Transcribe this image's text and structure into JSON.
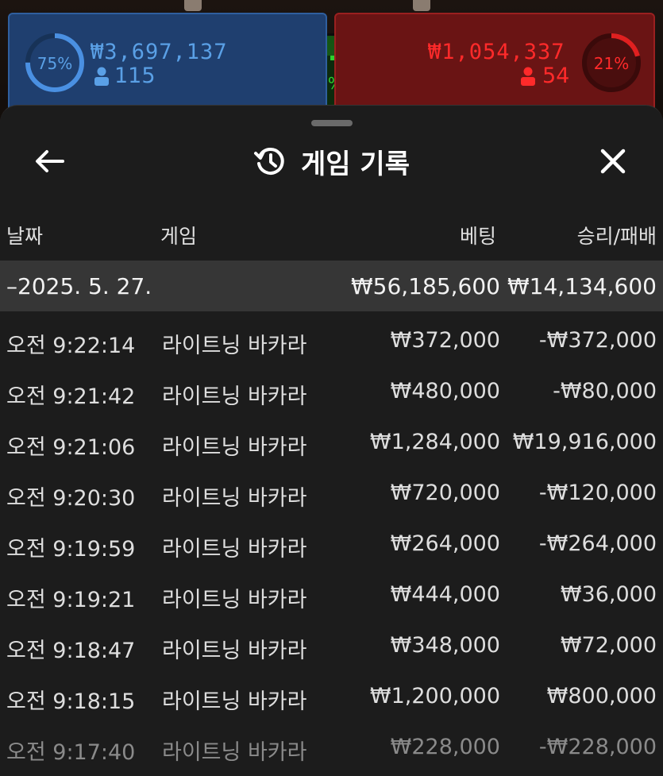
{
  "top": {
    "player": {
      "percent": "75%",
      "amount": "₩3,697,137",
      "count": "115"
    },
    "tie": {
      "percent": "4%"
    },
    "banker": {
      "percent": "21%",
      "amount": "₩1,054,337",
      "count": "54"
    }
  },
  "sheet": {
    "title": "게임 기록",
    "icons": {
      "back": "arrow-left-icon",
      "history": "history-icon",
      "close": "close-icon"
    },
    "columns": {
      "date": "날짜",
      "game": "게임",
      "bet": "베팅",
      "winloss": "승리/패배"
    },
    "date_group": {
      "date": "–2025. 5. 27.",
      "bet_total": "₩56,185,600",
      "winloss_total": "₩14,134,600"
    },
    "rows": [
      {
        "time": "오전 9:22:14",
        "game": "라이트닝 바카라",
        "bet": "₩372,000",
        "result": "-₩372,000"
      },
      {
        "time": "오전 9:21:42",
        "game": "라이트닝 바카라",
        "bet": "₩480,000",
        "result": "-₩80,000"
      },
      {
        "time": "오전 9:21:06",
        "game": "라이트닝 바카라",
        "bet": "₩1,284,000",
        "result": "₩19,916,000"
      },
      {
        "time": "오전 9:20:30",
        "game": "라이트닝 바카라",
        "bet": "₩720,000",
        "result": "-₩120,000"
      },
      {
        "time": "오전 9:19:59",
        "game": "라이트닝 바카라",
        "bet": "₩264,000",
        "result": "-₩264,000"
      },
      {
        "time": "오전 9:19:21",
        "game": "라이트닝 바카라",
        "bet": "₩444,000",
        "result": "₩36,000"
      },
      {
        "time": "오전 9:18:47",
        "game": "라이트닝 바카라",
        "bet": "₩348,000",
        "result": "₩72,000"
      },
      {
        "time": "오전 9:18:15",
        "game": "라이트닝 바카라",
        "bet": "₩1,200,000",
        "result": "₩800,000"
      },
      {
        "time": "오전 9:17:40",
        "game": "라이트닝 바카라",
        "bet": "₩228,000",
        "result": "-₩228,000"
      }
    ]
  },
  "colors": {
    "player": "#5aa0e6",
    "banker": "#ff2a2a",
    "tie": "#2ecf2e",
    "sheet_bg": "#1c1c1c",
    "date_row_bg": "#363636"
  }
}
